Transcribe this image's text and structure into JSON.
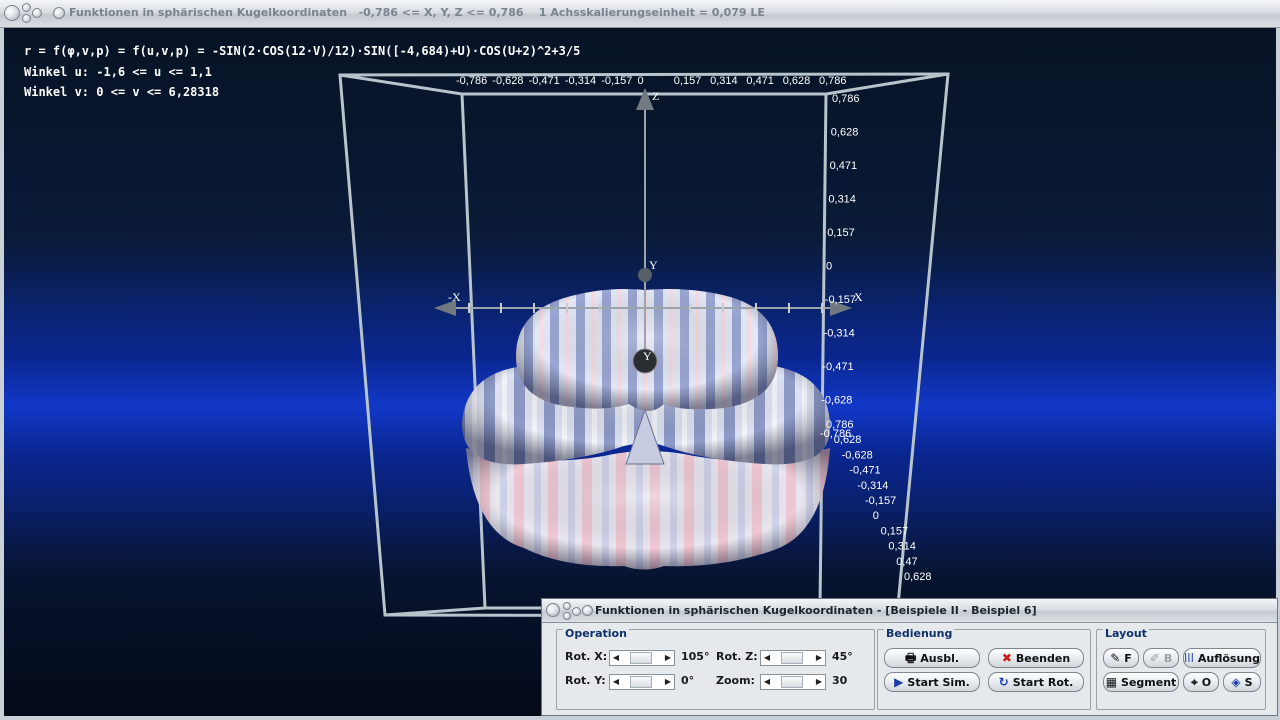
{
  "main_window": {
    "title": "Funktionen in sphärischen Kugelkoordinaten   -0,786 <= X, Y, Z <= 0,786    1 Achsskalierungseinheit = 0,079 LE"
  },
  "formulas": {
    "line1": "r = f(φ,v,p) = f(u,v,p) = -SIN(2·COS(12·V)/12)·SIN([-4,684)+U)·COS(U+2)^2+3/5",
    "line2": "Winkel u: -1,6 <= u <= 1,1",
    "line3": "Winkel v: 0 <= v <= 6,28318"
  },
  "axes": {
    "x_label": "X",
    "x_neg_label": "-X",
    "y_label": "Y",
    "y_neg_label": "Y",
    "z_label": "Z",
    "top_ticks": [
      "-0,786",
      "-0,628",
      "-0,471",
      "-0,314",
      "-0,157",
      "0",
      "0,157",
      "0,314",
      "0,471",
      "0,628",
      "0,786"
    ],
    "right_ticks": [
      "0,786",
      "0,628",
      "0,471",
      "0,314",
      "0,157",
      "0",
      "-0,157",
      "-0,314",
      "-0,471",
      "-0,628",
      "-0,786"
    ],
    "depth_ticks": [
      "0,786",
      "0,628",
      "-0,628",
      "-0,471",
      "-0,314",
      "-0,157",
      "0",
      "0,157",
      "0,314",
      "0,47",
      "0,628"
    ]
  },
  "colors": {
    "surface_light": "#dfe4f4",
    "surface_blue": "#8e9ac8",
    "surface_pink": "#f0c8d4",
    "frame": "#b8c4cc"
  },
  "control": {
    "title": "Funktionen in sphärischen Kugelkoordinaten - [Beispiele II - Beispiel 6]",
    "operation": {
      "label": "Operation",
      "rot_x_label": "Rot. X:",
      "rot_x_value": "105°",
      "rot_y_label": "Rot. Y:",
      "rot_y_value": "0°",
      "rot_z_label": "Rot. Z:",
      "rot_z_value": "45°",
      "zoom_label": "Zoom:",
      "zoom_value": "30"
    },
    "bedienung": {
      "label": "Bedienung",
      "ausbl": "Ausbl.",
      "beenden": "Beenden",
      "start_sim": "Start Sim.",
      "start_rot": "Start Rot."
    },
    "layout": {
      "label": "Layout",
      "f": "F",
      "b": "B",
      "aufloesung": "Auflösung",
      "segment": "Segment",
      "o": "O",
      "s": "S"
    }
  }
}
